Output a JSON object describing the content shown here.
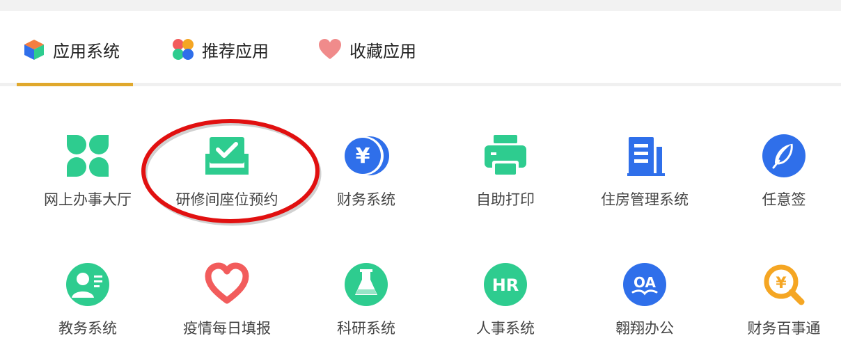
{
  "tabs": [
    {
      "label": "应用系统",
      "icon": "cube-icon",
      "active": true
    },
    {
      "label": "推荐应用",
      "icon": "four-petal-icon",
      "active": false
    },
    {
      "label": "收藏应用",
      "icon": "heart-icon",
      "active": false
    }
  ],
  "colors": {
    "accent": "#e0a82c",
    "green": "#2ecc8f",
    "blue": "#2f6fea",
    "red": "#f25c5c",
    "orange": "#f5a623",
    "annotation": "#e11010"
  },
  "apps": [
    {
      "label": "网上办事大厅",
      "icon": "clover-icon"
    },
    {
      "label": "研修间座位预约",
      "icon": "seat-booking-icon"
    },
    {
      "label": "财务系统",
      "icon": "yen-coin-icon"
    },
    {
      "label": "自助打印",
      "icon": "printer-icon"
    },
    {
      "label": "住房管理系统",
      "icon": "building-icon"
    },
    {
      "label": "任意签",
      "icon": "feather-icon"
    },
    {
      "label": "教务系统",
      "icon": "teacher-icon"
    },
    {
      "label": "疫情每日填报",
      "icon": "heart-outline-icon"
    },
    {
      "label": "科研系统",
      "icon": "flask-icon"
    },
    {
      "label": "人事系统",
      "icon": "hr-badge-icon"
    },
    {
      "label": "翱翔办公",
      "icon": "oa-icon"
    },
    {
      "label": "财务百事通",
      "icon": "yen-search-icon"
    }
  ],
  "text": {
    "hr": "HR",
    "oa": "OA",
    "yen": "¥"
  }
}
